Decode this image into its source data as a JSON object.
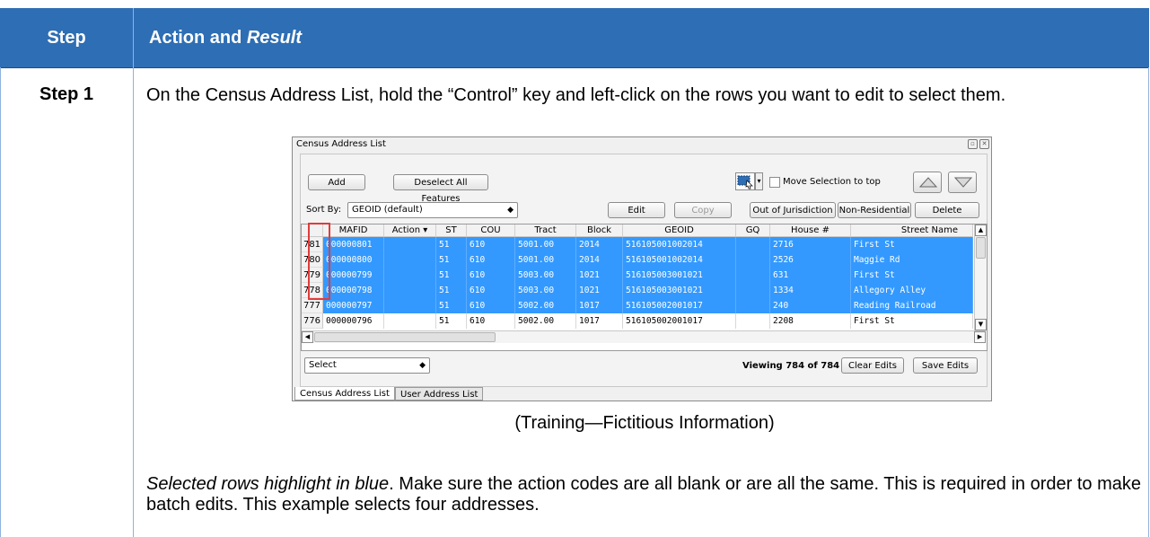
{
  "header": {
    "step_col": "Step",
    "action_col_plain": "Action and ",
    "action_col_italic": "Result"
  },
  "step": {
    "label": "Step 1"
  },
  "instruction": "On the Census Address List, hold the “Control” key and left-click on the rows you want to edit to select them.",
  "screenshot": {
    "window_title": "Census Address List",
    "buttons": {
      "add": "Add",
      "deselect": "Deselect All Features",
      "move_selection": "Move Selection to top",
      "edit": "Edit",
      "copy": "Copy",
      "out_of_jurisdiction": "Out of Jurisdiction",
      "non_residential": "Non-Residential",
      "delete": "Delete",
      "clear_edits": "Clear Edits",
      "save_edits": "Save Edits"
    },
    "sort_by_label": "Sort By:",
    "sort_by_value": "GEOID (default)",
    "select_value": "Select",
    "viewing": "Viewing 784 of 784",
    "columns": [
      "MAFID",
      "Action",
      "ST",
      "COU",
      "Tract",
      "Block",
      "GEOID",
      "GQ",
      "House #",
      "Street Name"
    ],
    "rows": [
      {
        "num": "781",
        "selected": true,
        "cells": [
          "000000801",
          "",
          "51",
          "610",
          "5001.00",
          "2014",
          "516105001002014",
          "",
          "2716",
          "First St"
        ]
      },
      {
        "num": "780",
        "selected": true,
        "cells": [
          "000000800",
          "",
          "51",
          "610",
          "5001.00",
          "2014",
          "516105001002014",
          "",
          "2526",
          "Maggie Rd"
        ]
      },
      {
        "num": "779",
        "selected": true,
        "cells": [
          "000000799",
          "",
          "51",
          "610",
          "5003.00",
          "1021",
          "516105003001021",
          "",
          "631",
          "First St"
        ]
      },
      {
        "num": "778",
        "selected": true,
        "cells": [
          "000000798",
          "",
          "51",
          "610",
          "5003.00",
          "1021",
          "516105003001021",
          "",
          "1334",
          "Allegory Alley"
        ]
      },
      {
        "num": "777",
        "selected": true,
        "cells": [
          "000000797",
          "",
          "51",
          "610",
          "5002.00",
          "1017",
          "516105002001017",
          "",
          "240",
          "Reading Railroad"
        ]
      },
      {
        "num": "776",
        "selected": false,
        "cells": [
          "000000796",
          "",
          "51",
          "610",
          "5002.00",
          "1017",
          "516105002001017",
          "",
          "2208",
          "First St"
        ]
      }
    ],
    "tabs": [
      "Census Address List",
      "User Address List"
    ]
  },
  "caption": "(Training—Fictitious Information)",
  "result_italic": "Selected rows highlight in blue",
  "result_rest": ". Make sure the action codes are all blank or are all the same. This is required in order to make batch edits. This example selects four addresses.",
  "colors": {
    "header_bg": "#2e6eb4",
    "selection_blue": "#3399ff",
    "highlight_box": "#e23b3b"
  }
}
